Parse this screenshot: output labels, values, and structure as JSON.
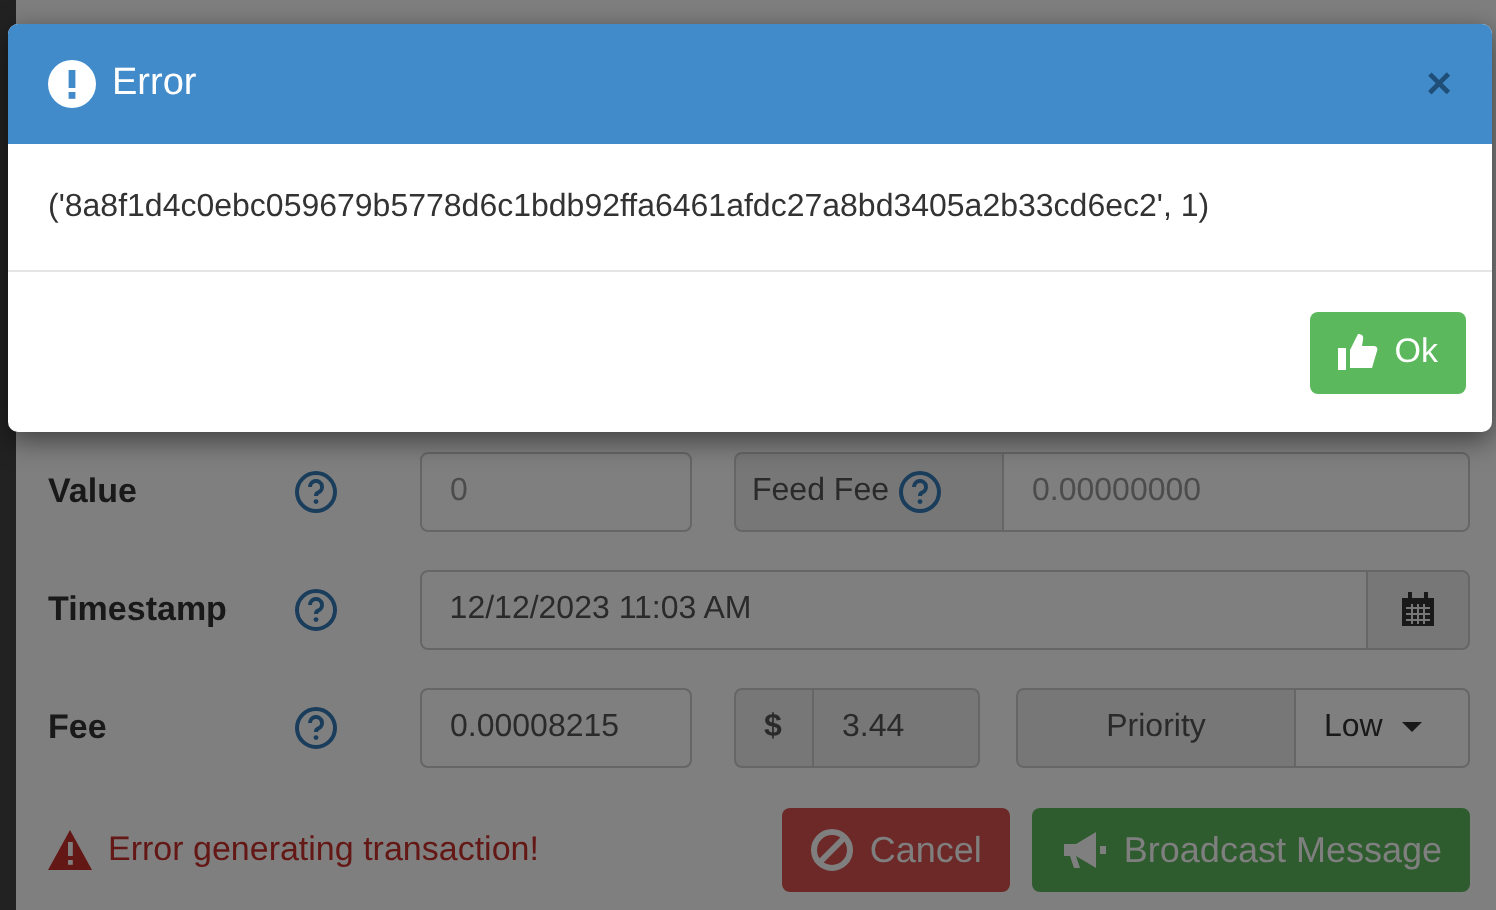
{
  "dialog": {
    "title": "Error",
    "close": "×",
    "message": "('8a8f1d4c0ebc059679b5778d6c1bdb92ffa6461afdc27a8bd3405a2b33cd6ec2', 1)",
    "ok_button": "Ok"
  },
  "form": {
    "value": {
      "label": "Value",
      "value": "0",
      "feed_fee_label": "Feed Fee",
      "feed_fee_value": "0.00000000"
    },
    "timestamp": {
      "label": "Timestamp",
      "value": "12/12/2023 11:03 AM"
    },
    "fee": {
      "label": "Fee",
      "value": "0.00008215",
      "currency": "$",
      "usd": "3.44",
      "priority_label": "Priority",
      "priority": "Low"
    },
    "error": "Error generating transaction!",
    "cancel_button": "Cancel",
    "broadcast_button": "Broadcast Message"
  }
}
